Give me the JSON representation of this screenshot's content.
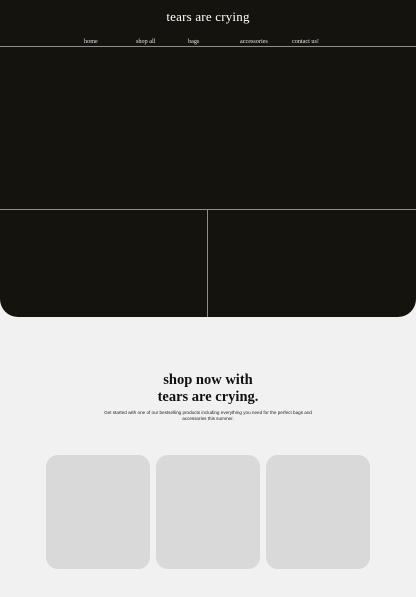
{
  "header": {
    "brand": "tears are crying"
  },
  "nav": {
    "items": [
      "home",
      "shop all",
      "bags",
      "accessories",
      "contact us!"
    ]
  },
  "section": {
    "title_line1": "shop now with",
    "title_line2": "tears are crying.",
    "description": "Get started with one of our bestselling products including everything you need for the perfect bags and accessories this summer."
  },
  "colors": {
    "hero_bg": "#14130e",
    "page_bg": "#f1f1f1",
    "card_bg": "#d9d9d9",
    "divider": "#8f8f8a"
  }
}
